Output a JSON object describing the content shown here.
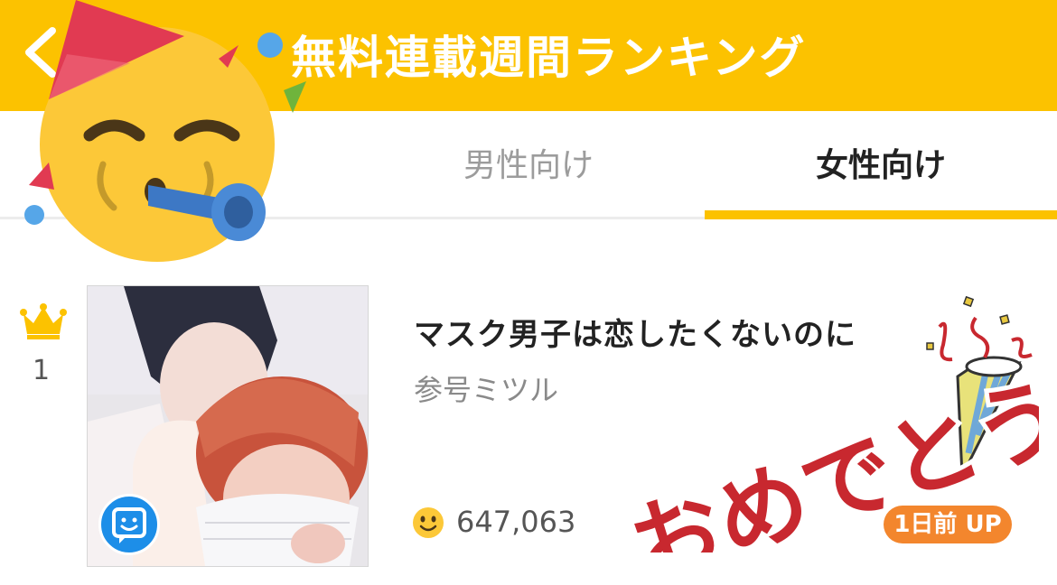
{
  "header": {
    "back_icon": "chevron-left-icon",
    "title": "無料連載週間ランキング"
  },
  "tabs": [
    {
      "label": "男性向け",
      "active": false
    },
    {
      "label": "女性向け",
      "active": true
    }
  ],
  "colors": {
    "accent": "#fcc200",
    "badge": "#f3862d",
    "comment_badge": "#1d8ee8",
    "congrats": "#c8282f"
  },
  "ranking": [
    {
      "rank": "1",
      "rank_icon": "crown-icon",
      "title": "マスク男子は恋したくないのに",
      "author": "参号ミツル",
      "views": "647,063",
      "views_icon": "smile-icon",
      "badge": "1日前 UP",
      "cover_badge_icon": "comment-badge-icon"
    }
  ],
  "stickers": {
    "party_emoji": "party-face-icon",
    "congrats": {
      "icon": "party-popper-icon",
      "text": "おめでとう"
    }
  }
}
